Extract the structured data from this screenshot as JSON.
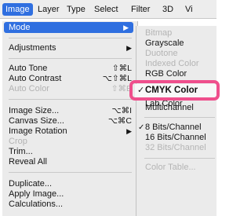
{
  "menubar": {
    "items": [
      "Image",
      "Layer",
      "Type",
      "Select",
      "Filter",
      "3D",
      "Vi"
    ],
    "active_index": 0
  },
  "image_menu": {
    "items": [
      {
        "label": "Mode",
        "shortcut": "",
        "submenu": true,
        "disabled": false,
        "highlighted": true
      },
      {
        "label": "Adjustments",
        "shortcut": "",
        "submenu": true,
        "disabled": false
      },
      {
        "label": "Auto Tone",
        "shortcut": "⇧⌘L",
        "disabled": false
      },
      {
        "label": "Auto Contrast",
        "shortcut": "⌥⇧⌘L",
        "disabled": false
      },
      {
        "label": "Auto Color",
        "shortcut": "⇧⌘B",
        "disabled": true
      },
      {
        "label": "Image Size...",
        "shortcut": "⌥⌘I",
        "disabled": false
      },
      {
        "label": "Canvas Size...",
        "shortcut": "⌥⌘C",
        "disabled": false
      },
      {
        "label": "Image Rotation",
        "shortcut": "",
        "submenu": true,
        "disabled": false
      },
      {
        "label": "Crop",
        "shortcut": "",
        "disabled": true
      },
      {
        "label": "Trim...",
        "shortcut": "",
        "disabled": false
      },
      {
        "label": "Reveal All",
        "shortcut": "",
        "disabled": false
      },
      {
        "label": "Duplicate...",
        "shortcut": "",
        "disabled": false
      },
      {
        "label": "Apply Image...",
        "shortcut": "",
        "disabled": false
      },
      {
        "label": "Calculations...",
        "shortcut": "",
        "disabled": false
      }
    ],
    "arrow": "▶"
  },
  "mode_submenu": {
    "items": [
      {
        "label": "Bitmap",
        "disabled": true
      },
      {
        "label": "Grayscale",
        "disabled": false
      },
      {
        "label": "Duotone",
        "disabled": true
      },
      {
        "label": "Indexed Color",
        "disabled": true
      },
      {
        "label": "RGB Color",
        "disabled": false
      },
      {
        "label": "CMYK Color",
        "checked": true,
        "selected": true
      },
      {
        "label": "Lab Color",
        "disabled": false
      },
      {
        "label": "Multichannel",
        "disabled": false
      },
      {
        "label": "8 Bits/Channel",
        "checked": true
      },
      {
        "label": "16 Bits/Channel",
        "disabled": false
      },
      {
        "label": "32 Bits/Channel",
        "disabled": true
      },
      {
        "label": "Color Table...",
        "disabled": true
      }
    ],
    "check_mark": "✓",
    "highlight_color": "#ef4f8c"
  },
  "colors": {
    "accent": "#2f6fe0",
    "menu_bg": "#ebebeb",
    "disabled_text": "#b2b2b2"
  }
}
